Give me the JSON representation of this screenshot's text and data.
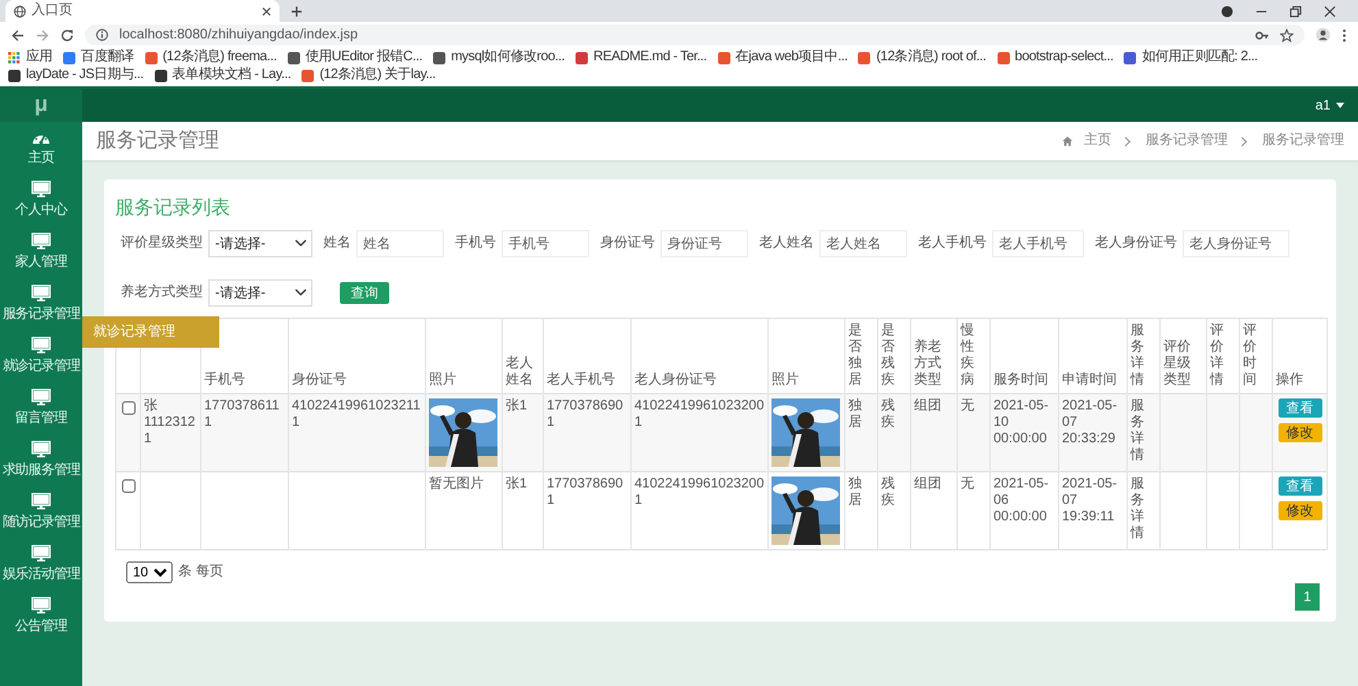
{
  "browser": {
    "tab_title": "入口页",
    "url": "localhost:8080/zhihuiyangdao/index.jsp",
    "bookmarks": [
      {
        "kind": "apps",
        "label": "应用"
      },
      {
        "kind": "site",
        "label": "百度翻译",
        "color": "#2f7cf6"
      },
      {
        "kind": "site",
        "label": "(12条消息) freema...",
        "color": "#e8542f"
      },
      {
        "kind": "site",
        "label": "使用UEditor 报错C...",
        "color": "#555555"
      },
      {
        "kind": "site",
        "label": "mysql如何修改roo...",
        "color": "#555555"
      },
      {
        "kind": "site",
        "label": "README.md - Ter...",
        "color": "#d23b3b"
      },
      {
        "kind": "site",
        "label": "在java web项目中...",
        "color": "#e8542f"
      },
      {
        "kind": "site",
        "label": "(12条消息) root of...",
        "color": "#e8542f"
      },
      {
        "kind": "site",
        "label": "bootstrap-select...",
        "color": "#e8542f"
      },
      {
        "kind": "site",
        "label": "如何用正则匹配: 2...",
        "color": "#4a5bd4"
      },
      {
        "kind": "site",
        "label": "layDate - JS日期与...",
        "color": "#333333"
      },
      {
        "kind": "site",
        "label": "表单模块文档 - Lay...",
        "color": "#333333"
      },
      {
        "kind": "site",
        "label": "(12条消息) 关于lay...",
        "color": "#e8542f"
      }
    ]
  },
  "sidebar": {
    "logo": "μ",
    "items": [
      {
        "kind": "dashboard",
        "label": "主页"
      },
      {
        "kind": "monitor",
        "label": "个人中心"
      },
      {
        "kind": "monitor",
        "label": "家人管理"
      },
      {
        "kind": "monitor",
        "label": "服务记录管理"
      },
      {
        "kind": "monitor",
        "label": "就诊记录管理",
        "tooltip": "就诊记录管理"
      },
      {
        "kind": "monitor",
        "label": "留言管理"
      },
      {
        "kind": "monitor",
        "label": "求助服务管理"
      },
      {
        "kind": "monitor",
        "label": "随访记录管理"
      },
      {
        "kind": "monitor",
        "label": "娱乐活动管理"
      },
      {
        "kind": "monitor",
        "label": "公告管理"
      }
    ]
  },
  "topbar": {
    "user": "a1"
  },
  "page_header": {
    "title": "服务记录管理",
    "breadcrumb": [
      "主页",
      "服务记录管理",
      "服务记录管理"
    ]
  },
  "card": {
    "title": "服务记录列表",
    "filters": [
      {
        "kind": "select",
        "label": "评价星级类型",
        "value": "-请选择-"
      },
      {
        "kind": "text",
        "label": "姓名",
        "placeholder": "姓名"
      },
      {
        "kind": "text",
        "label": "手机号",
        "placeholder": "手机号"
      },
      {
        "kind": "text",
        "label": "身份证号",
        "placeholder": "身份证号"
      },
      {
        "kind": "text",
        "label": "老人姓名",
        "placeholder": "老人姓名"
      },
      {
        "kind": "text",
        "label": "老人手机号",
        "placeholder": "老人手机号"
      },
      {
        "kind": "text",
        "label": "老人身份证号",
        "placeholder": "老人身份证号"
      },
      {
        "kind": "select",
        "label": "养老方式类型",
        "value": "-请选择-"
      }
    ],
    "search_button": "查询"
  },
  "table": {
    "columns": [
      {
        "kind": "covered"
      },
      {
        "kind": "covered"
      },
      {
        "kind": "text",
        "label": "手机号"
      },
      {
        "kind": "text",
        "label": "身份证号"
      },
      {
        "kind": "text",
        "label": "照片"
      },
      {
        "kind": "text",
        "label": "老人姓名"
      },
      {
        "kind": "text",
        "label": "老人手机号"
      },
      {
        "kind": "text",
        "label": "老人身份证号"
      },
      {
        "kind": "text",
        "label": "照片"
      },
      {
        "kind": "text",
        "label": "是否独居"
      },
      {
        "kind": "text",
        "label": "是否残疾"
      },
      {
        "kind": "text",
        "label": "养老方式类型"
      },
      {
        "kind": "text",
        "label": "慢性疾病"
      },
      {
        "kind": "text",
        "label": "服务时间"
      },
      {
        "kind": "text",
        "label": "申请时间"
      },
      {
        "kind": "text",
        "label": "服务详情"
      },
      {
        "kind": "text",
        "label": "评价星级类型"
      },
      {
        "kind": "text",
        "label": "评价详情"
      },
      {
        "kind": "text",
        "label": "评价时间"
      },
      {
        "kind": "text",
        "label": "操作"
      }
    ],
    "rows": [
      {
        "cells": [
          {
            "kind": "checkbox",
            "checked": false
          },
          {
            "kind": "text",
            "text": "张11123121"
          },
          {
            "kind": "text",
            "text": "17703786111"
          },
          {
            "kind": "text",
            "text": "410224199610232111"
          },
          {
            "kind": "picture"
          },
          {
            "kind": "text",
            "text": "张1"
          },
          {
            "kind": "text",
            "text": "17703786901"
          },
          {
            "kind": "text",
            "text": "410224199610232001"
          },
          {
            "kind": "picture"
          },
          {
            "kind": "text",
            "text": "独居"
          },
          {
            "kind": "text",
            "text": "残疾"
          },
          {
            "kind": "text",
            "text": "组团"
          },
          {
            "kind": "text",
            "text": "无"
          },
          {
            "kind": "text",
            "text": "2021-05-10 00:00:00"
          },
          {
            "kind": "text",
            "text": "2021-05-07 20:33:29"
          },
          {
            "kind": "text",
            "text": "服务详情"
          },
          {
            "kind": "empty"
          },
          {
            "kind": "empty"
          },
          {
            "kind": "empty"
          },
          {
            "kind": "actions",
            "buttons": [
              {
                "kind": "view",
                "label": "查看"
              },
              {
                "kind": "edit",
                "label": "修改"
              }
            ]
          }
        ]
      },
      {
        "cells": [
          {
            "kind": "checkbox",
            "checked": false
          },
          {
            "kind": "empty"
          },
          {
            "kind": "empty"
          },
          {
            "kind": "empty"
          },
          {
            "kind": "text",
            "text": "暂无图片"
          },
          {
            "kind": "text",
            "text": "张1"
          },
          {
            "kind": "text",
            "text": "17703786901"
          },
          {
            "kind": "text",
            "text": "410224199610232001"
          },
          {
            "kind": "picture"
          },
          {
            "kind": "text",
            "text": "独居"
          },
          {
            "kind": "text",
            "text": "残疾"
          },
          {
            "kind": "text",
            "text": "组团"
          },
          {
            "kind": "text",
            "text": "无"
          },
          {
            "kind": "text",
            "text": "2021-05-06 00:00:00"
          },
          {
            "kind": "text",
            "text": "2021-05-07 19:39:11"
          },
          {
            "kind": "text",
            "text": "服务详情"
          },
          {
            "kind": "empty"
          },
          {
            "kind": "empty"
          },
          {
            "kind": "empty"
          },
          {
            "kind": "actions",
            "buttons": [
              {
                "kind": "view",
                "label": "查看"
              },
              {
                "kind": "edit",
                "label": "修改"
              }
            ]
          }
        ]
      }
    ]
  },
  "pagination": {
    "page_size": "10",
    "page_size_label": "条 每页",
    "pages": [
      {
        "label": "1",
        "selected": true
      }
    ]
  }
}
